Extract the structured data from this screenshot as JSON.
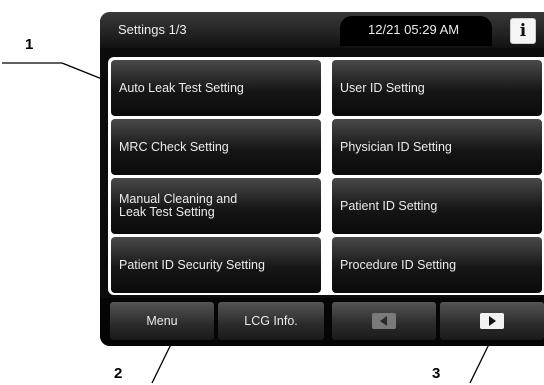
{
  "header": {
    "title": "Settings 1/3",
    "datetime": "12/21 05:29 AM",
    "info_label": "i"
  },
  "settings_buttons": [
    "Auto Leak Test Setting",
    "User ID Setting",
    "MRC Check Setting",
    "Physician ID Setting",
    "Manual Cleaning and\nLeak Test Setting",
    "Patient ID Setting",
    "Patient ID Security Setting",
    "Procedure ID Setting"
  ],
  "footer": {
    "menu_label": "Menu",
    "lcg_info_label": "LCG Info.",
    "prev_icon": "left-arrow-icon",
    "next_icon": "right-arrow-icon"
  },
  "callouts": [
    "1",
    "2",
    "3"
  ],
  "colors": {
    "screen_bg": "#0b0b0b",
    "button_text": "#ececec",
    "prev_arrow_box": "#7a7a7a",
    "next_arrow_box": "#f2f2f2"
  }
}
